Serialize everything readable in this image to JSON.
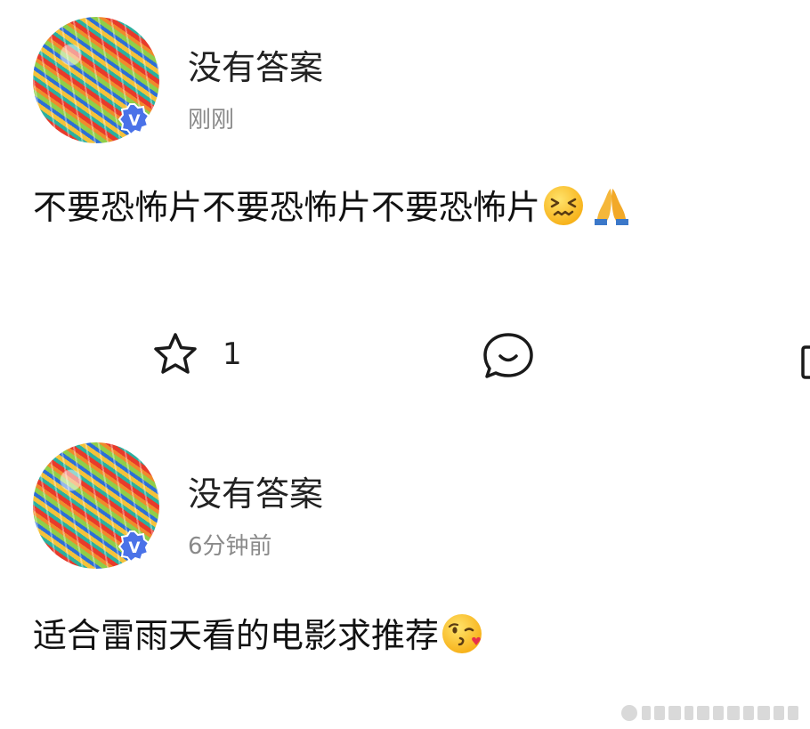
{
  "posts": [
    {
      "author": "没有答案",
      "time": "刚刚",
      "content": "不要恐怖片不要恐怖片不要恐怖片",
      "emojis": [
        "confounded-face",
        "folded-hands"
      ],
      "actions": {
        "like_count": "1"
      }
    },
    {
      "author": "没有答案",
      "time": "6分钟前",
      "content": "适合雷雨天看的电影求推荐",
      "emojis": [
        "face-blowing-kiss"
      ]
    }
  ],
  "colors": {
    "verified_badge": "#4a72e8",
    "time_text": "#8a8a8a",
    "icon_stroke": "#1a1a1a"
  },
  "icons": [
    "star-icon",
    "comment-icon",
    "verified-badge-icon"
  ]
}
